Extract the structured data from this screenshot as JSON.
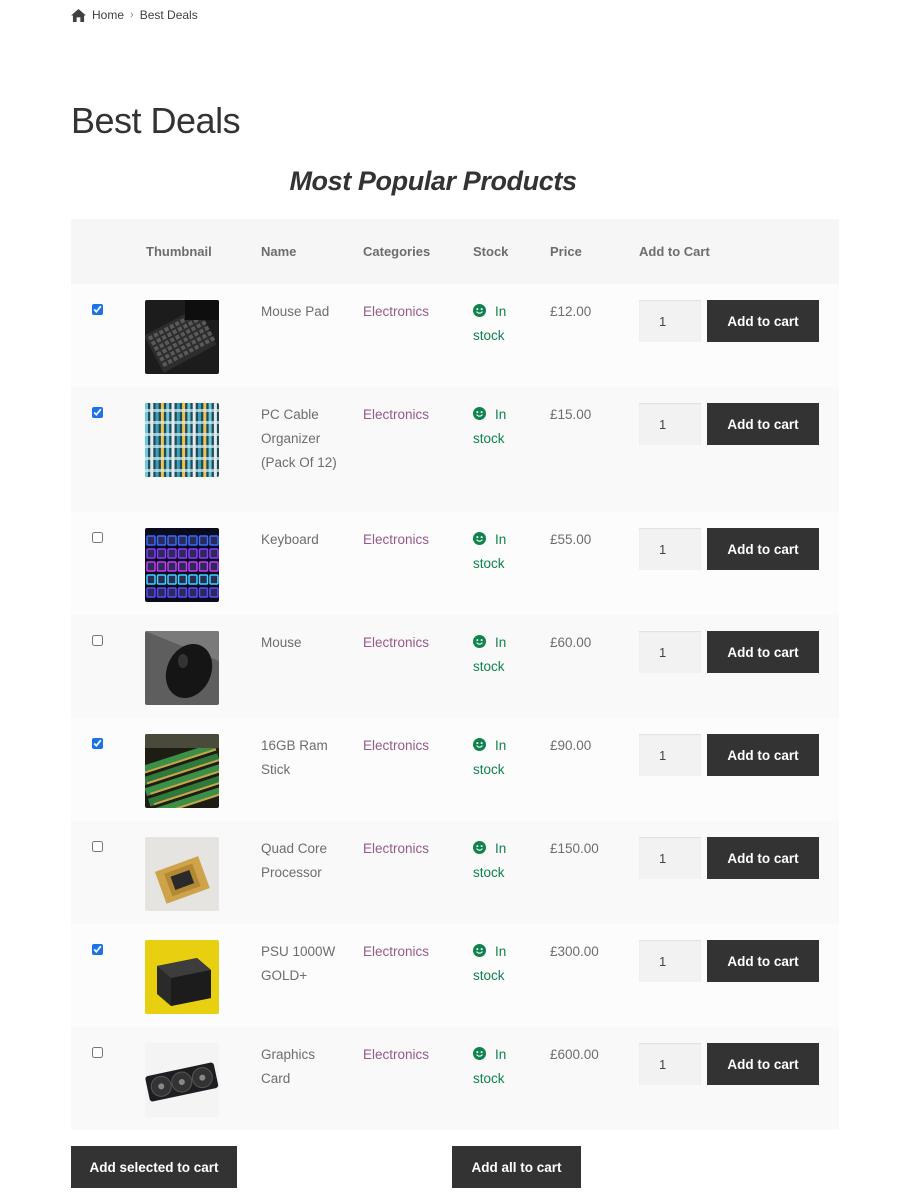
{
  "breadcrumb": {
    "home": "Home",
    "current": "Best Deals"
  },
  "page_title": "Best Deals",
  "section_title": "Most Popular Products",
  "table": {
    "headers": {
      "thumbnail": "Thumbnail",
      "name": "Name",
      "categories": "Categories",
      "stock": "Stock",
      "price": "Price",
      "add_to_cart": "Add to Cart"
    },
    "rows": [
      {
        "selected": true,
        "name": "Mouse Pad",
        "category": "Electronics",
        "stock": "In stock",
        "price": "£12.00",
        "qty": "1",
        "button": "Add to cart",
        "thumb": "keyboard-dark"
      },
      {
        "selected": true,
        "name": "PC Cable Organizer (Pack Of 12)",
        "category": "Electronics",
        "stock": "In stock",
        "price": "£15.00",
        "qty": "1",
        "button": "Add to cart",
        "thumb": "cables"
      },
      {
        "selected": false,
        "name": "Keyboard",
        "category": "Electronics",
        "stock": "In stock",
        "price": "£55.00",
        "qty": "1",
        "button": "Add to cart",
        "thumb": "keyboard-rgb"
      },
      {
        "selected": false,
        "name": "Mouse",
        "category": "Electronics",
        "stock": "In stock",
        "price": "£60.00",
        "qty": "1",
        "button": "Add to cart",
        "thumb": "mouse"
      },
      {
        "selected": true,
        "name": "16GB Ram Stick",
        "category": "Electronics",
        "stock": "In stock",
        "price": "£90.00",
        "qty": "1",
        "button": "Add to cart",
        "thumb": "ram"
      },
      {
        "selected": false,
        "name": "Quad Core Processor",
        "category": "Electronics",
        "stock": "In stock",
        "price": "£150.00",
        "qty": "1",
        "button": "Add to cart",
        "thumb": "cpu"
      },
      {
        "selected": true,
        "name": "PSU 1000W GOLD+",
        "category": "Electronics",
        "stock": "In stock",
        "price": "£300.00",
        "qty": "1",
        "button": "Add to cart",
        "thumb": "psu"
      },
      {
        "selected": false,
        "name": "Graphics Card",
        "category": "Electronics",
        "stock": "In stock",
        "price": "£600.00",
        "qty": "1",
        "button": "Add to cart",
        "thumb": "gpu"
      }
    ]
  },
  "actions": {
    "add_selected": "Add selected to cart",
    "add_all": "Add all to cart"
  },
  "colors": {
    "button_bg": "#333333",
    "category_link": "#96588a",
    "stock_ok": "#0f834d"
  }
}
